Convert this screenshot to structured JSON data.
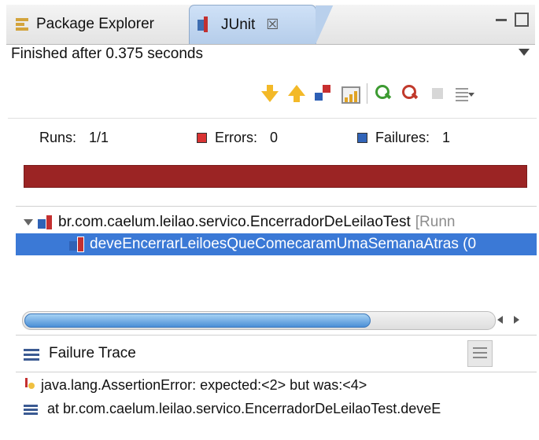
{
  "tabs": [
    {
      "label": "Package Explorer",
      "icon": "package-explorer-icon",
      "active": false
    },
    {
      "label": "JUnit",
      "icon": "junit-icon",
      "active": true,
      "close": "☒"
    }
  ],
  "status": {
    "text": "Finished after 0.375 seconds"
  },
  "counters": {
    "runs_label": "Runs:",
    "runs_value": "1/1",
    "errors_label": "Errors:",
    "errors_value": "0",
    "failures_label": "Failures:",
    "failures_value": "1"
  },
  "colors": {
    "progress_failure": "#9b2424",
    "selection": "#3b79d6",
    "error_marker": "#d93333",
    "failure_marker": "#3164b8"
  },
  "tree": {
    "suite": {
      "name": "br.com.caelum.leilao.servico.EncerradorDeLeilaoTest",
      "runner": "[Runn"
    },
    "test": {
      "name": "deveEncerrarLeiloesQueComecaramUmaSemanaAtras (0"
    }
  },
  "failure_trace": {
    "title": "Failure Trace",
    "lines": [
      "java.lang.AssertionError: expected:<2> but was:<4>",
      "at br.com.caelum.leilao.servico.EncerradorDeLeilaoTest.deveE"
    ]
  }
}
